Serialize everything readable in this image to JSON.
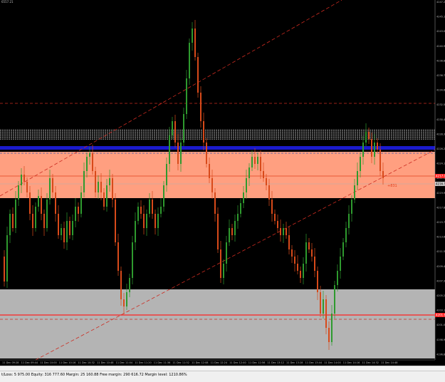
{
  "header": {
    "text": "6557.21"
  },
  "status": {
    "text": "t/Loss: 5 975.00  Equity: 316 777.60  Margin: 25 160.88  Free margin: 290 616.72  Margin level: 1210.86%"
  },
  "chart_data": {
    "type": "candlestick",
    "price_labels": [
      "4247.20",
      "4245.10",
      "4243.00",
      "4240.90",
      "4238.80",
      "4236.70",
      "4234.60",
      "4232.50",
      "4230.40",
      "4228.30",
      "4226.20",
      "4224.10",
      "4222.00",
      "4219.90",
      "4217.80",
      "4215.70",
      "4213.60",
      "4211.50",
      "4209.40",
      "4207.30",
      "4205.20",
      "4203.10",
      "4201.00",
      "4198.90",
      "4196.80"
    ],
    "time_labels": [
      "11 Dec 09:28",
      "11 Dec 09:44",
      "11 Dec 10:00",
      "11 Dec 10:16",
      "11 Dec 10:32",
      "11 Dec 10:48",
      "11 Dec 11:04",
      "11 Dec 11:20",
      "11 Dec 11:36",
      "11 Dec 11:52",
      "11 Dec 12:08",
      "11 Dec 12:24",
      "11 Dec 12:40",
      "11 Dec 12:56",
      "11 Dec 13:12",
      "11 Dec 13:28",
      "11 Dec 13:44",
      "11 Dec 14:00",
      "11 Dec 14:16",
      "11 Dec 14:32",
      "11 Dec 14:48"
    ],
    "current_price_label": "4217.0",
    "bid_label": "4216.5",
    "low_marker_label": "4201.6",
    "annotation": "+831",
    "colors": {
      "background": "#000000",
      "up_candle": "#2e9a2e",
      "down_candle": "#d84a1a",
      "resistance_zone": "#ff9f80",
      "support_zone": "#b4b4b4",
      "blue_band": "#1a1acc",
      "dashed_red": "#cc2b20",
      "solid_red": "#ff2020"
    }
  }
}
